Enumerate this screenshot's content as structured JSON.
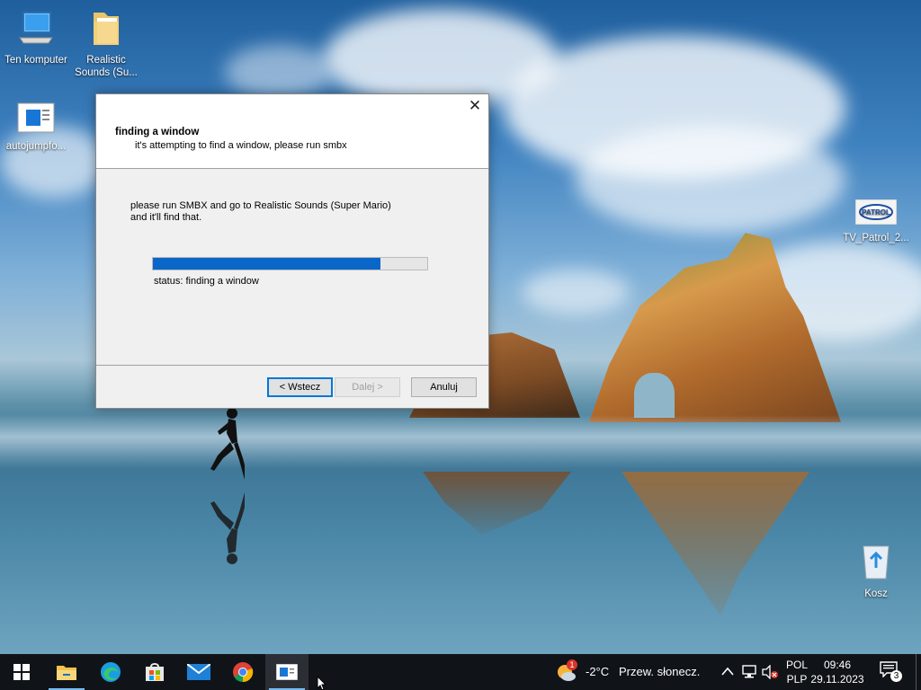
{
  "desktop": {
    "icons": [
      {
        "label": "Ten komputer"
      },
      {
        "label": "Realistic Sounds (Su..."
      },
      {
        "label": "autojumpfo..."
      },
      {
        "label": "TV_Patrol_2..."
      },
      {
        "label": "Kosz"
      }
    ],
    "tv_patrol_logo_text": "PATROL"
  },
  "dialog": {
    "close_glyph": "✕",
    "header_title": "finding a window",
    "header_subtitle": "it's attempting to find a window, please run smbx",
    "body_line1": "please run SMBX and go to Realistic Sounds (Super Mario)",
    "body_line2": "and it'll find that.",
    "progress_fraction": 0.83,
    "progress_color": "#0a66c8",
    "status": "status: finding a window",
    "buttons": {
      "back": "< Wstecz",
      "next": "Dalej >",
      "cancel": "Anuluj"
    }
  },
  "taskbar": {
    "apps": [
      {
        "icon": "windows-start-icon"
      },
      {
        "icon": "file-explorer-icon"
      },
      {
        "icon": "edge-icon"
      },
      {
        "icon": "microsoft-store-icon"
      },
      {
        "icon": "mail-icon"
      },
      {
        "icon": "chrome-icon"
      },
      {
        "icon": "installer-app-icon"
      }
    ],
    "weather": {
      "temp": "-2°C",
      "desc": "Przew. słonecz.",
      "badge": "1"
    },
    "lang_top": "POL",
    "lang_bottom": "PLP",
    "time": "09:46",
    "date": "29.11.2023",
    "notification_count": "3"
  }
}
